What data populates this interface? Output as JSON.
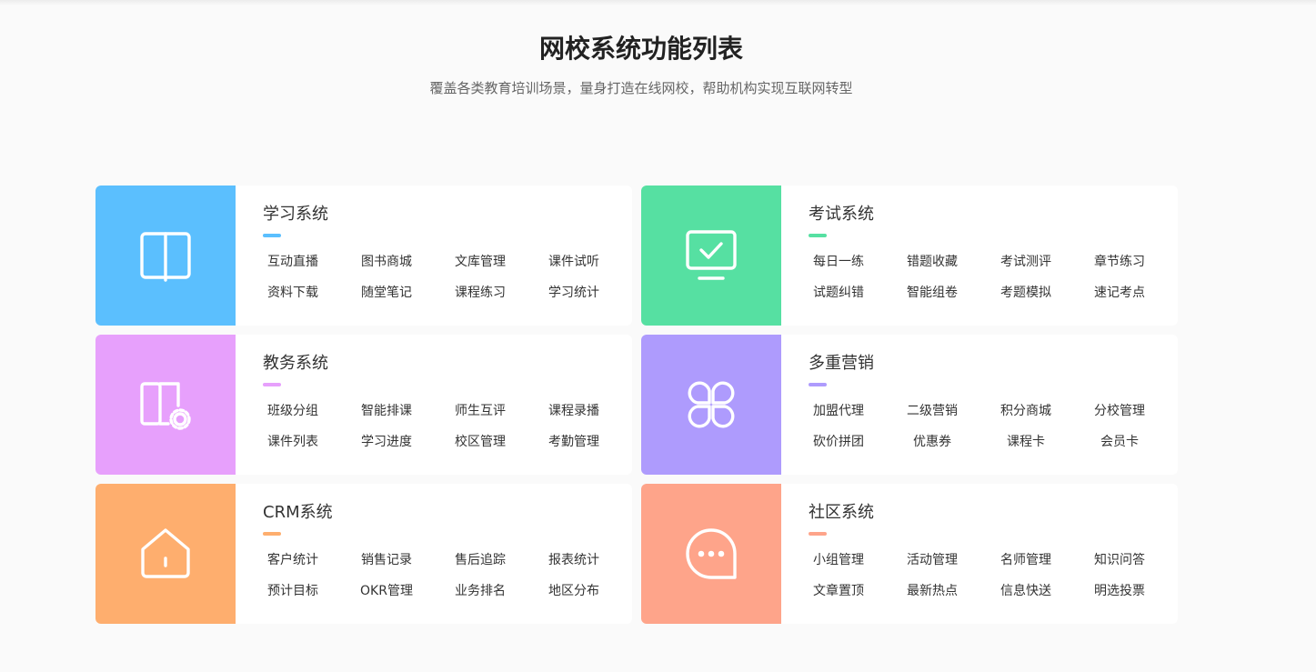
{
  "header": {
    "title": "网校系统功能列表",
    "subtitle": "覆盖各类教育培训场景，量身打造在线网校，帮助机构实现互联网转型"
  },
  "cards": [
    {
      "id": "learning",
      "title": "学习系统",
      "color": "#5bbffe",
      "icon": "book-icon",
      "items": [
        "互动直播",
        "图书商城",
        "文库管理",
        "课件试听",
        "资料下载",
        "随堂笔记",
        "课程练习",
        "学习统计"
      ]
    },
    {
      "id": "exam",
      "title": "考试系统",
      "color": "#56e0a2",
      "icon": "monitor-check-icon",
      "items": [
        "每日一练",
        "错题收藏",
        "考试测评",
        "章节练习",
        "试题纠错",
        "智能组卷",
        "考题模拟",
        "速记考点"
      ]
    },
    {
      "id": "academic",
      "title": "教务系统",
      "color": "#e7a0fc",
      "icon": "door-gear-icon",
      "items": [
        "班级分组",
        "智能排课",
        "师生互评",
        "课程录播",
        "课件列表",
        "学习进度",
        "校区管理",
        "考勤管理"
      ]
    },
    {
      "id": "marketing",
      "title": "多重营销",
      "color": "#ae9bfd",
      "icon": "clover-icon",
      "items": [
        "加盟代理",
        "二级营销",
        "积分商城",
        "分校管理",
        "砍价拼团",
        "优惠券",
        "课程卡",
        "会员卡"
      ]
    },
    {
      "id": "crm",
      "title": "CRM系统",
      "color": "#feae6e",
      "icon": "home-icon",
      "items": [
        "客户统计",
        "销售记录",
        "售后追踪",
        "报表统计",
        "预计目标",
        "OKR管理",
        "业务排名",
        "地区分布"
      ]
    },
    {
      "id": "community",
      "title": "社区系统",
      "color": "#fea48a",
      "icon": "chat-bubble-icon",
      "items": [
        "小组管理",
        "活动管理",
        "名师管理",
        "知识问答",
        "文章置顶",
        "最新热点",
        "信息快送",
        "明选投票"
      ]
    }
  ]
}
